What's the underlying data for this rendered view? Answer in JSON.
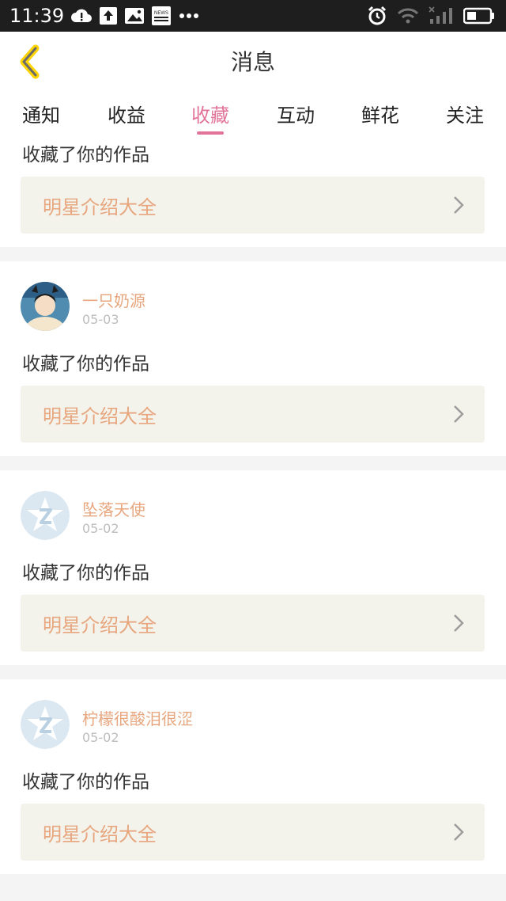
{
  "status_bar": {
    "time": "11:39",
    "left_icons": [
      "cloud-alert-icon",
      "upload-icon",
      "image-icon",
      "news-icon",
      "more-icon"
    ],
    "right_icons": [
      "alarm-icon",
      "wifi-icon",
      "signal-icon",
      "battery-icon"
    ],
    "news_label": "NEWS"
  },
  "header": {
    "title": "消息",
    "back_icon": "chevron-left-icon"
  },
  "tabs": [
    {
      "label": "通知"
    },
    {
      "label": "收益"
    },
    {
      "label": "收藏"
    },
    {
      "label": "互动"
    },
    {
      "label": "鲜花"
    },
    {
      "label": "关注"
    }
  ],
  "active_tab": "收藏",
  "colors": {
    "accent": "#e2749a",
    "author": "#e7a67e",
    "box_bg": "#f3f3ec"
  },
  "items": [
    {
      "action": "收藏了你的作品",
      "work_title": "明星介绍大全"
    },
    {
      "author": "一只奶源",
      "date": "05-03",
      "avatar": "photo-avatar",
      "action": "收藏了你的作品",
      "work_title": "明星介绍大全"
    },
    {
      "author": "坠落天使",
      "date": "05-02",
      "avatar": "default-avatar-icon",
      "action": "收藏了你的作品",
      "work_title": "明星介绍大全"
    },
    {
      "author": "柠檬很酸泪很涩",
      "date": "05-02",
      "avatar": "default-avatar-icon",
      "action": "收藏了你的作品",
      "work_title": "明星介绍大全"
    }
  ]
}
